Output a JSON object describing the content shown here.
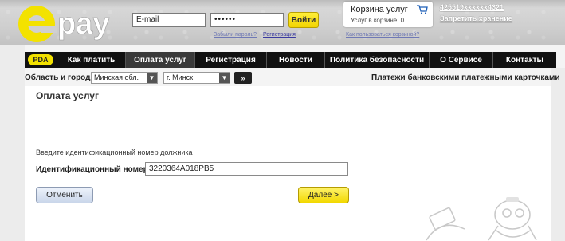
{
  "header": {
    "logo": "epay",
    "email_value": "E-mail",
    "password_value": "••••••",
    "login_label": "Войти",
    "forgot_link": "Забыли пароль?",
    "register_link": "Регистрация",
    "cart_help_link": "Как пользоваться корзиной?",
    "cart_title": "Корзина услуг",
    "cart_subtitle": "Услуг в корзине: 0",
    "user_id": "425519xxxxxx4321",
    "forbid_storage_link": "Запретить хранение"
  },
  "nav": {
    "pda_label": "PDA",
    "items": [
      {
        "label": "Как платить",
        "active": false
      },
      {
        "label": "Оплата услуг",
        "active": true
      },
      {
        "label": "Регистрация",
        "active": false
      },
      {
        "label": "Новости",
        "active": false
      },
      {
        "label": "Политика безопасности",
        "active": false
      },
      {
        "label": "О Сервисе",
        "active": false
      },
      {
        "label": "Контакты",
        "active": false
      }
    ]
  },
  "filters": {
    "label": "Область и город:",
    "region_value": "Минская обл.",
    "city_value": "г. Минск",
    "go_label": "»",
    "promo_text": "Платежи банковскими платежными карточками"
  },
  "main": {
    "title": "Оплата услуг",
    "hint": "Введите идентификационный номер должника",
    "id_label": "Идентификационный номер:",
    "id_value": "3220364A018PB5",
    "cancel_label": "Отменить",
    "next_label": "Далее >"
  },
  "colors": {
    "brand_yellow": "#f3e200",
    "nav_bg": "#111111",
    "link_blue": "#3a3aa0"
  }
}
